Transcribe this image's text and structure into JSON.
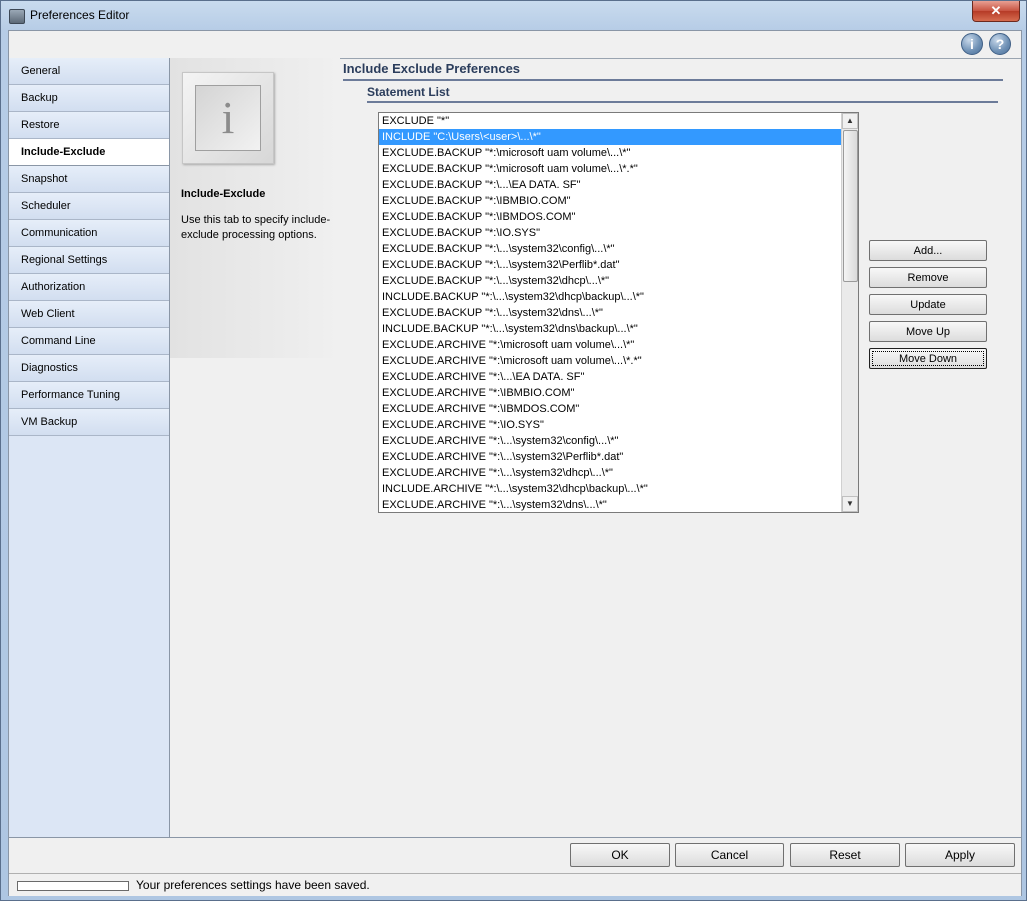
{
  "window": {
    "title": "Preferences Editor",
    "close_glyph": "✕"
  },
  "toolbar": {
    "info_glyph": "i",
    "help_glyph": "?"
  },
  "sidebar": {
    "items": [
      {
        "label": "General"
      },
      {
        "label": "Backup"
      },
      {
        "label": "Restore"
      },
      {
        "label": "Include-Exclude",
        "active": true
      },
      {
        "label": "Snapshot"
      },
      {
        "label": "Scheduler"
      },
      {
        "label": "Communication"
      },
      {
        "label": "Regional Settings"
      },
      {
        "label": "Authorization"
      },
      {
        "label": "Web Client"
      },
      {
        "label": "Command Line"
      },
      {
        "label": "Diagnostics"
      },
      {
        "label": "Performance Tuning"
      },
      {
        "label": "VM Backup"
      }
    ]
  },
  "info": {
    "icon_glyph": "i",
    "title": "Include-Exclude",
    "description": "Use this tab to specify include-exclude processing options."
  },
  "main": {
    "heading": "Include Exclude Preferences",
    "subheading": "Statement List",
    "statements": [
      "EXCLUDE \"*\"",
      "INCLUDE \"C:\\Users\\<user>\\...\\*\"",
      "EXCLUDE.BACKUP \"*:\\microsoft uam volume\\...\\*\"",
      "EXCLUDE.BACKUP \"*:\\microsoft uam volume\\...\\*.*\"",
      "EXCLUDE.BACKUP \"*:\\...\\EA DATA. SF\"",
      "EXCLUDE.BACKUP \"*:\\IBMBIO.COM\"",
      "EXCLUDE.BACKUP \"*:\\IBMDOS.COM\"",
      "EXCLUDE.BACKUP \"*:\\IO.SYS\"",
      "EXCLUDE.BACKUP \"*:\\...\\system32\\config\\...\\*\"",
      "EXCLUDE.BACKUP \"*:\\...\\system32\\Perflib*.dat\"",
      "EXCLUDE.BACKUP \"*:\\...\\system32\\dhcp\\...\\*\"",
      "INCLUDE.BACKUP \"*:\\...\\system32\\dhcp\\backup\\...\\*\"",
      "EXCLUDE.BACKUP \"*:\\...\\system32\\dns\\...\\*\"",
      "INCLUDE.BACKUP \"*:\\...\\system32\\dns\\backup\\...\\*\"",
      "EXCLUDE.ARCHIVE \"*:\\microsoft uam volume\\...\\*\"",
      "EXCLUDE.ARCHIVE \"*:\\microsoft uam volume\\...\\*.*\"",
      "EXCLUDE.ARCHIVE \"*:\\...\\EA DATA. SF\"",
      "EXCLUDE.ARCHIVE \"*:\\IBMBIO.COM\"",
      "EXCLUDE.ARCHIVE \"*:\\IBMDOS.COM\"",
      "EXCLUDE.ARCHIVE \"*:\\IO.SYS\"",
      "EXCLUDE.ARCHIVE \"*:\\...\\system32\\config\\...\\*\"",
      "EXCLUDE.ARCHIVE \"*:\\...\\system32\\Perflib*.dat\"",
      "EXCLUDE.ARCHIVE \"*:\\...\\system32\\dhcp\\...\\*\"",
      "INCLUDE.ARCHIVE \"*:\\...\\system32\\dhcp\\backup\\...\\*\"",
      "EXCLUDE.ARCHIVE \"*:\\...\\system32\\dns\\...\\*\""
    ],
    "selected_index": 1,
    "scroll_up_glyph": "▲",
    "scroll_down_glyph": "▼",
    "buttons": {
      "add": "Add...",
      "remove": "Remove",
      "update": "Update",
      "move_up": "Move Up",
      "move_down": "Move Down"
    }
  },
  "footer": {
    "ok": "OK",
    "cancel": "Cancel",
    "reset": "Reset",
    "apply": "Apply"
  },
  "status": {
    "text": "Your preferences settings have been saved."
  }
}
